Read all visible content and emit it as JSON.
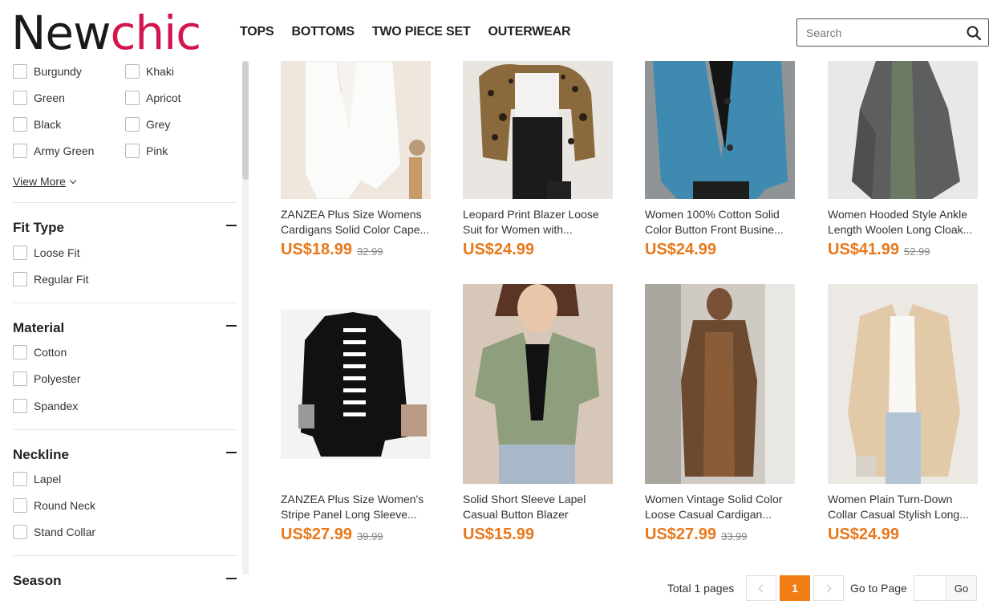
{
  "header": {
    "logo_new": "New",
    "logo_chic": "chic",
    "nav": [
      "TOPS",
      "BOTTOMS",
      "TWO PIECE SET",
      "OUTERWEAR"
    ],
    "search_placeholder": "Search"
  },
  "sidebar": {
    "colors": [
      "Burgundy",
      "Khaki",
      "Green",
      "Apricot",
      "Black",
      "Grey",
      "Army Green",
      "Pink"
    ],
    "view_more": "View More",
    "sections": [
      {
        "title": "Fit Type",
        "options": [
          "Loose Fit",
          "Regular Fit"
        ]
      },
      {
        "title": "Material",
        "options": [
          "Cotton",
          "Polyester",
          "Spandex"
        ]
      },
      {
        "title": "Neckline",
        "options": [
          "Lapel",
          "Round Neck",
          "Stand Collar"
        ]
      },
      {
        "title": "Season",
        "options": []
      }
    ]
  },
  "products": [
    {
      "line1": "ZANZEA Plus Size Womens",
      "line2": "Cardigans Solid Color Cape...",
      "price": "US$18.99",
      "old": "32.99",
      "color": "white-cardigan"
    },
    {
      "line1": "Leopard Print Blazer Loose",
      "line2": "Suit for Women with...",
      "price": "US$24.99",
      "old": "",
      "color": "leopard"
    },
    {
      "line1": "Women 100% Cotton Solid",
      "line2": "Color Button Front Busine...",
      "price": "US$24.99",
      "old": "",
      "color": "blue"
    },
    {
      "line1": "Women Hooded Style Ankle",
      "line2": "Length Woolen Long Cloak...",
      "price": "US$41.99",
      "old": "52.99",
      "color": "grey-cloak"
    },
    {
      "line1": "ZANZEA Plus Size Women's",
      "line2": "Stripe Panel Long Sleeve...",
      "price": "US$27.99",
      "old": "39.99",
      "color": "black-blazer"
    },
    {
      "line1": "Solid Short Sleeve Lapel",
      "line2": "Casual Button Blazer",
      "price": "US$15.99",
      "old": "",
      "color": "green"
    },
    {
      "line1": "Women Vintage Solid Color",
      "line2": "Loose Casual Cardigan...",
      "price": "US$27.99",
      "old": "33.99",
      "color": "brown"
    },
    {
      "line1": "Women Plain Turn-Down",
      "line2": "Collar Casual Stylish Long...",
      "price": "US$24.99",
      "old": "",
      "color": "beige"
    }
  ],
  "pagination": {
    "total": "Total 1 pages",
    "current": "1",
    "goto_label": "Go to Page",
    "go": "Go"
  }
}
